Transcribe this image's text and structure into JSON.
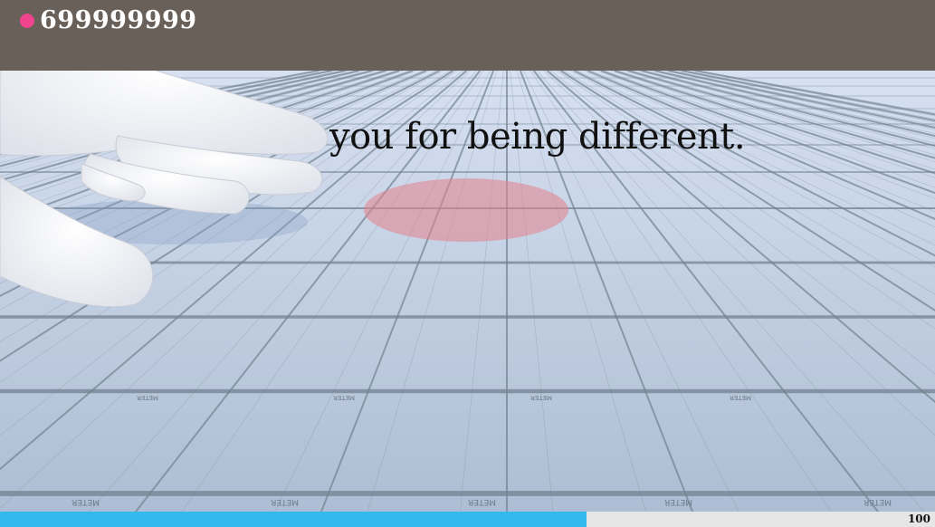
{
  "hud": {
    "score": "699999999",
    "score_dot_color": "#f0458e"
  },
  "message": {
    "text": "you for being different."
  },
  "scene": {
    "floor_color": "#b6c5dd",
    "grid_color": "#707f8e",
    "target_color": "#e8a0aa",
    "hand_color": "#f5f6fa",
    "floor_label": "METER"
  },
  "progress": {
    "fraction": 0.627,
    "label": "100",
    "fill_color": "#33b9ed"
  }
}
